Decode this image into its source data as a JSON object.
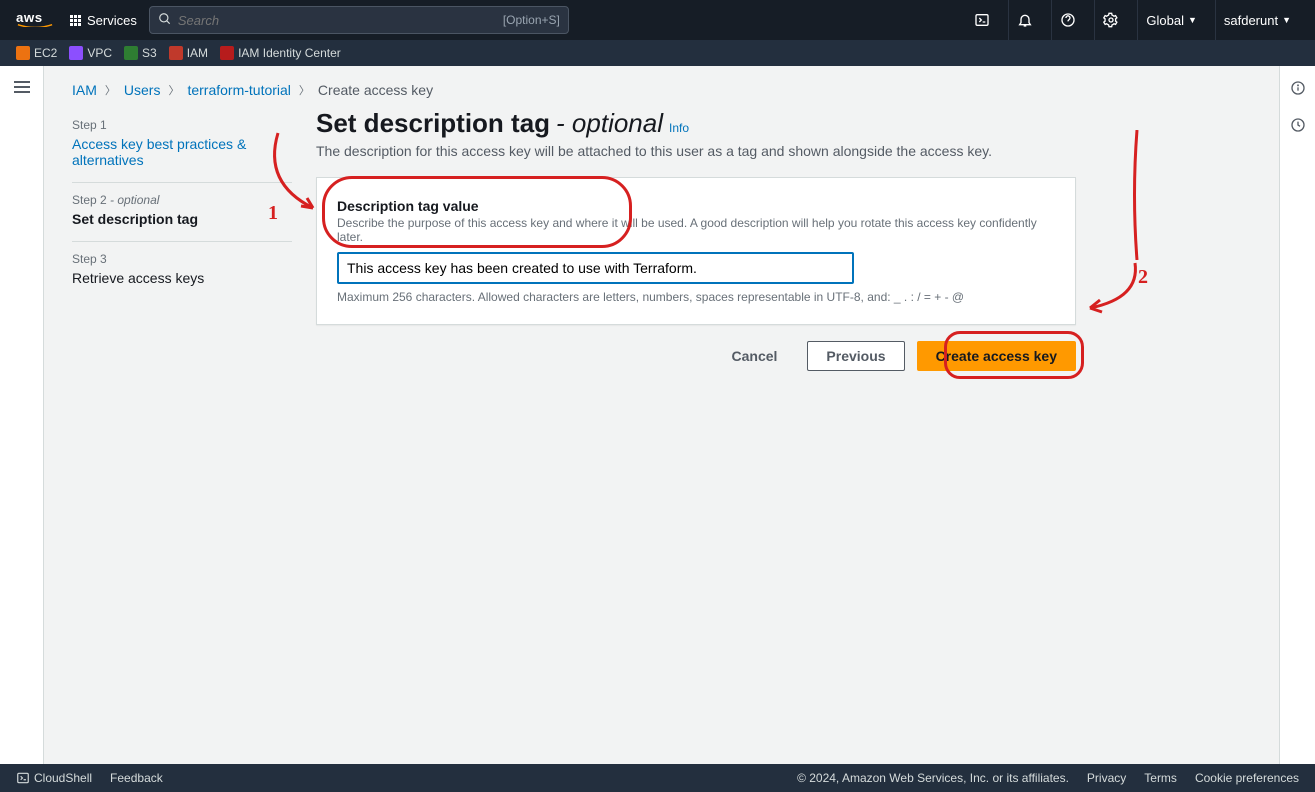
{
  "topnav": {
    "logo_text": "aws",
    "services_label": "Services",
    "search_placeholder": "Search",
    "search_hint": "[Option+S]",
    "region": "Global",
    "username": "safderunt"
  },
  "shortcuts": [
    {
      "label": "EC2"
    },
    {
      "label": "VPC"
    },
    {
      "label": "S3"
    },
    {
      "label": "IAM"
    },
    {
      "label": "IAM Identity Center"
    }
  ],
  "breadcrumb": {
    "items": [
      "IAM",
      "Users",
      "terraform-tutorial"
    ],
    "current": "Create access key"
  },
  "wizard": {
    "step1_label": "Step 1",
    "step1_title": "Access key best practices & alternatives",
    "step2_label": "Step 2",
    "step2_opt": "- optional",
    "step2_title": "Set description tag",
    "step3_label": "Step 3",
    "step3_title": "Retrieve access keys"
  },
  "page": {
    "heading_main": "Set description tag",
    "heading_optional": "- optional",
    "info": "Info",
    "description": "The description for this access key will be attached to this user as a tag and shown alongside the access key."
  },
  "form": {
    "field_label": "Description tag value",
    "field_hint": "Describe the purpose of this access key and where it will be used. A good description will help you rotate this access key confidently later.",
    "field_value": "This access key has been created to use with Terraform.",
    "field_constraint": "Maximum 256 characters. Allowed characters are letters, numbers, spaces representable in UTF-8, and: _ . : / = + - @"
  },
  "actions": {
    "cancel": "Cancel",
    "previous": "Previous",
    "create": "Create access key"
  },
  "annotations": {
    "n1": "1",
    "n2": "2"
  },
  "footer": {
    "cloudshell": "CloudShell",
    "feedback": "Feedback",
    "copyright": "© 2024, Amazon Web Services, Inc. or its affiliates.",
    "privacy": "Privacy",
    "terms": "Terms",
    "cookies": "Cookie preferences"
  }
}
